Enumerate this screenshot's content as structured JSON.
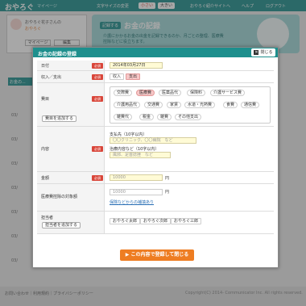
{
  "header": {
    "brand": "おやろぐ",
    "brand_sub": "マイページ",
    "font_size_label": "文字サイズの変更",
    "font_small": "小さい",
    "font_large": "大きい",
    "nav": [
      "おやろぐ紹介サイトへ",
      "ヘルプ",
      "ログアウト"
    ]
  },
  "profile": {
    "name": "おやろぐ花子さんの",
    "sub": "おやろぐ",
    "buttons": [
      "マイページ",
      "編集"
    ]
  },
  "hero": {
    "badge": "記録する",
    "title": "お金の記録",
    "text": "介護にかかるお金の出金を記録できるのか、月ごとの整理、医療費控除などに役立ちます。"
  },
  "background": {
    "tab": "お金の...",
    "years": [
      "03/",
      "03/",
      "03/",
      "03/",
      "03/",
      "03/",
      "03/"
    ]
  },
  "modal": {
    "title": "お金の記録の登録",
    "close": "閉じる",
    "required": "必須",
    "date": {
      "label": "日付",
      "value": "2014年03月27日"
    },
    "type": {
      "label": "収入／支出",
      "options": [
        "収入",
        "支出"
      ],
      "selected": "支出"
    },
    "expense": {
      "label": "費目",
      "add_button": "費目を追加する",
      "chips": [
        "交際費",
        "医療費",
        "医薬品代",
        "保険料",
        "介護サービス費",
        "介護用品代",
        "交通費",
        "家賃",
        "水道・光熱費",
        "食費",
        "通信費",
        "雑費代",
        "税金",
        "雑費",
        "その他支出"
      ],
      "selected": "医療費"
    },
    "detail": {
      "label": "内容",
      "payee_label": "支払先（10字以内）",
      "payee_placeholder": "〇〇クリニック、〇〇病院　など",
      "content_label": "治療内容など（10字以内）",
      "content_placeholder": "風邪、足首捻挫　など"
    },
    "amount": {
      "label": "金額",
      "placeholder": "10000",
      "unit": "円"
    },
    "deduction": {
      "label": "医療費控除の対象額",
      "placeholder": "10000",
      "unit": "円",
      "link": "保険などからの補填あり"
    },
    "person": {
      "label": "担当者",
      "add_button": "担当者を追加する",
      "options": [
        "おやろぐ太郎",
        "おやろぐ次郎",
        "おやろぐ三郎"
      ]
    },
    "submit": "この内容で登録して閉じる"
  },
  "footer": {
    "links": "お問い合わせ｜利用規約｜プライバシーポリシー",
    "copyright": "Copyright(C) 2014- Communicator Inc. All rights reserved."
  },
  "colors": {
    "teal": "#1e8f8d",
    "orange": "#ee7d22",
    "required_red": "#d9463a",
    "selected_pink": "#f7c7c7"
  }
}
